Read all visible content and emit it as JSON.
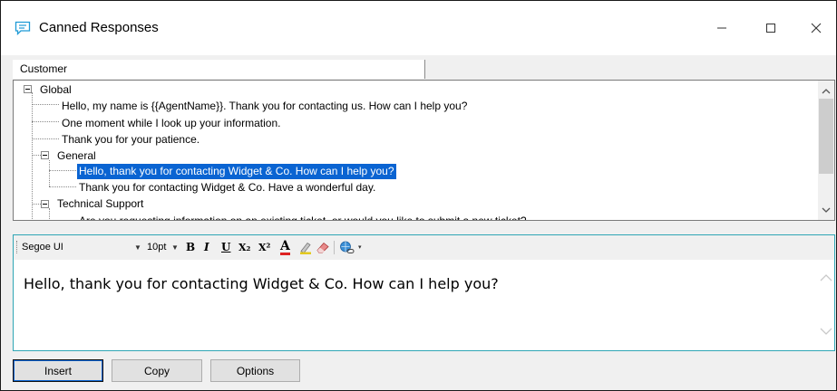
{
  "window": {
    "title": "Canned Responses"
  },
  "tree": {
    "column_header": "Customer",
    "items": [
      {
        "label": "Global"
      },
      {
        "label": "Hello, my name is {{AgentName}}. Thank you for contacting us. How can I help you?"
      },
      {
        "label": "One moment while I look up your information."
      },
      {
        "label": "Thank you for your patience."
      },
      {
        "label": "General"
      },
      {
        "label": "Hello, thank you for contacting Widget & Co. How can I help you?",
        "selected": true
      },
      {
        "label": "Thank you for contacting Widget & Co. Have a wonderful day."
      },
      {
        "label": "Technical Support"
      },
      {
        "label": "Are you requesting information on an existing ticket, or would you like to submit a new ticket?"
      }
    ]
  },
  "toolbar": {
    "font_name": "Segoe UI",
    "font_size": "10pt",
    "bold": "B",
    "italic": "I",
    "underline": "U",
    "subscript": "X₂",
    "superscript": "X²",
    "font_color_glyph": "A"
  },
  "editor": {
    "text": "Hello, thank you for contacting Widget & Co. How can I help you?"
  },
  "buttons": {
    "insert": "Insert",
    "copy": "Copy",
    "options": "Options"
  },
  "colors": {
    "selection": "#0a64d2",
    "editor_border": "#2fa6b5",
    "title_icon": "#1e9ad6"
  }
}
